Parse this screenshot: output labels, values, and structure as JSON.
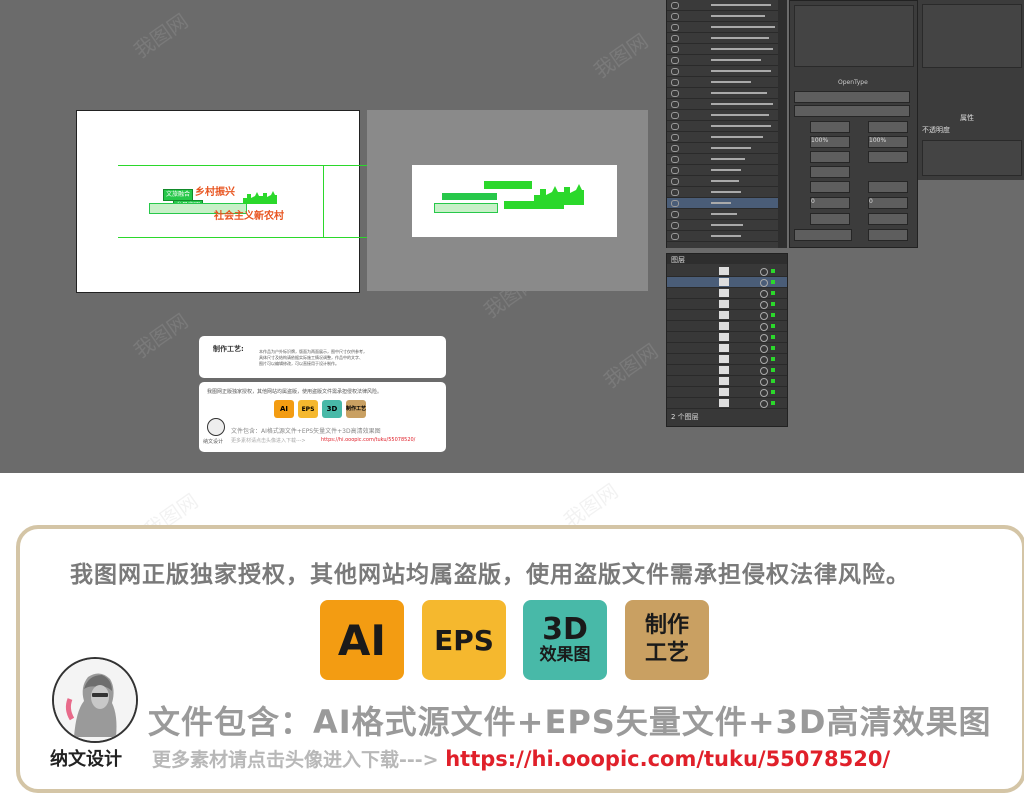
{
  "workspace": {
    "background": "#6b6b6b",
    "guide_color": "#2bd82b",
    "artboard_texts": {
      "banner_top": "文旅融合",
      "banner_bottom": "乡风文明",
      "orange_1": "乡村振兴",
      "orange_2": "社会主义新农村"
    }
  },
  "sample_card": {
    "title": "制作工艺:",
    "body_lines": [
      "本作品为户外标识牌，版面为两面展示，图中尺寸仅供参考，",
      "具体尺寸及结构请依据实际施工情况调整，作品中的文字、",
      "图片可以编辑修改，可以直接用于设计制作。"
    ],
    "notice": "我图网正版独家授权，其他网站均属盗版，使用盗版文件需承担侵权法律风险。",
    "badges": [
      "AI",
      "EPS",
      "3D",
      "制作工艺"
    ],
    "includes": "文件包含：AI格式源文件+EPS矢量文件+3D高清效果图",
    "more": "更多素材请点击头像进入下载--->",
    "link": "https://hi.ooopic.com/tuku/55078520/",
    "author": "纳文设计"
  },
  "panels": {
    "char_tab": "OpenType",
    "layers_label": "图层",
    "layers_count": "2 个图层",
    "right_tab": "属性",
    "right_label": "不透明度",
    "font_sizes": [
      "100%",
      "100%",
      "0",
      "0"
    ]
  },
  "watermark": "我图网",
  "footer": {
    "notice": "我图网正版独家授权，其他网站均属盗版，使用盗版文件需承担侵权法律风险。",
    "badge_ai": "AI",
    "badge_eps": "EPS",
    "badge_3d_big": "3D",
    "badge_3d_small": "效果图",
    "badge_craft_1": "制作",
    "badge_craft_2": "工艺",
    "author": "纳文设计",
    "includes": "文件包含：AI格式源文件+EPS矢量文件+3D高清效果图",
    "more": "更多素材请点击头像进入下载--->",
    "link": "https://hi.ooopic.com/tuku/55078520/"
  }
}
